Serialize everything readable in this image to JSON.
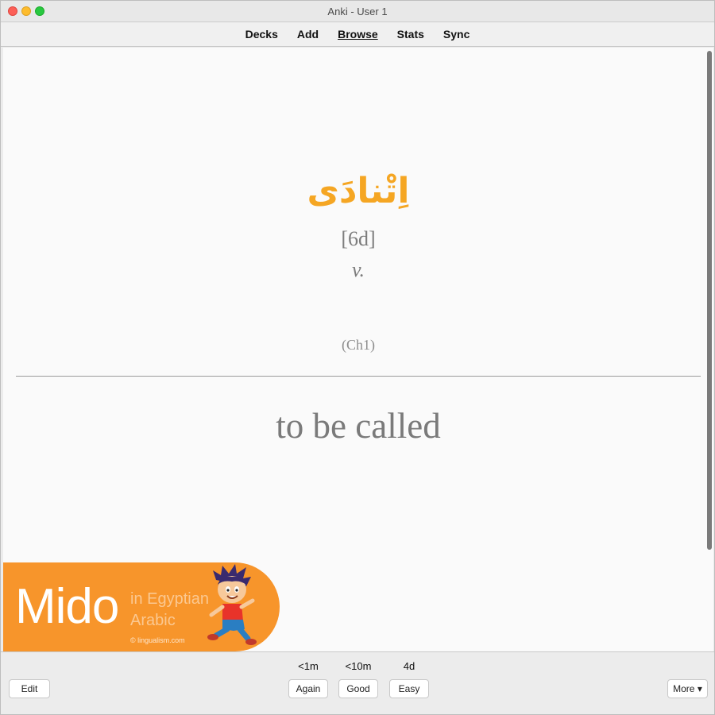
{
  "window": {
    "title": "Anki - User 1"
  },
  "toolbar": {
    "decks": "Decks",
    "add": "Add",
    "browse": "Browse",
    "stats": "Stats",
    "sync": "Sync"
  },
  "card": {
    "arabic": "اِتْنادَى",
    "pronunciation": "[6d]",
    "part_of_speech": "v.",
    "chapter": "(Ch1)",
    "meaning": "to be called"
  },
  "banner": {
    "logo": "Mido",
    "subtitle_line1": "in Egyptian",
    "subtitle_line2": "Arabic",
    "copyright": "© lingualism.com"
  },
  "bottom": {
    "edit": "Edit",
    "again_interval": "<1m",
    "good_interval": "<10m",
    "easy_interval": "4d",
    "again": "Again",
    "good": "Good",
    "easy": "Easy",
    "more": "More ▾"
  }
}
